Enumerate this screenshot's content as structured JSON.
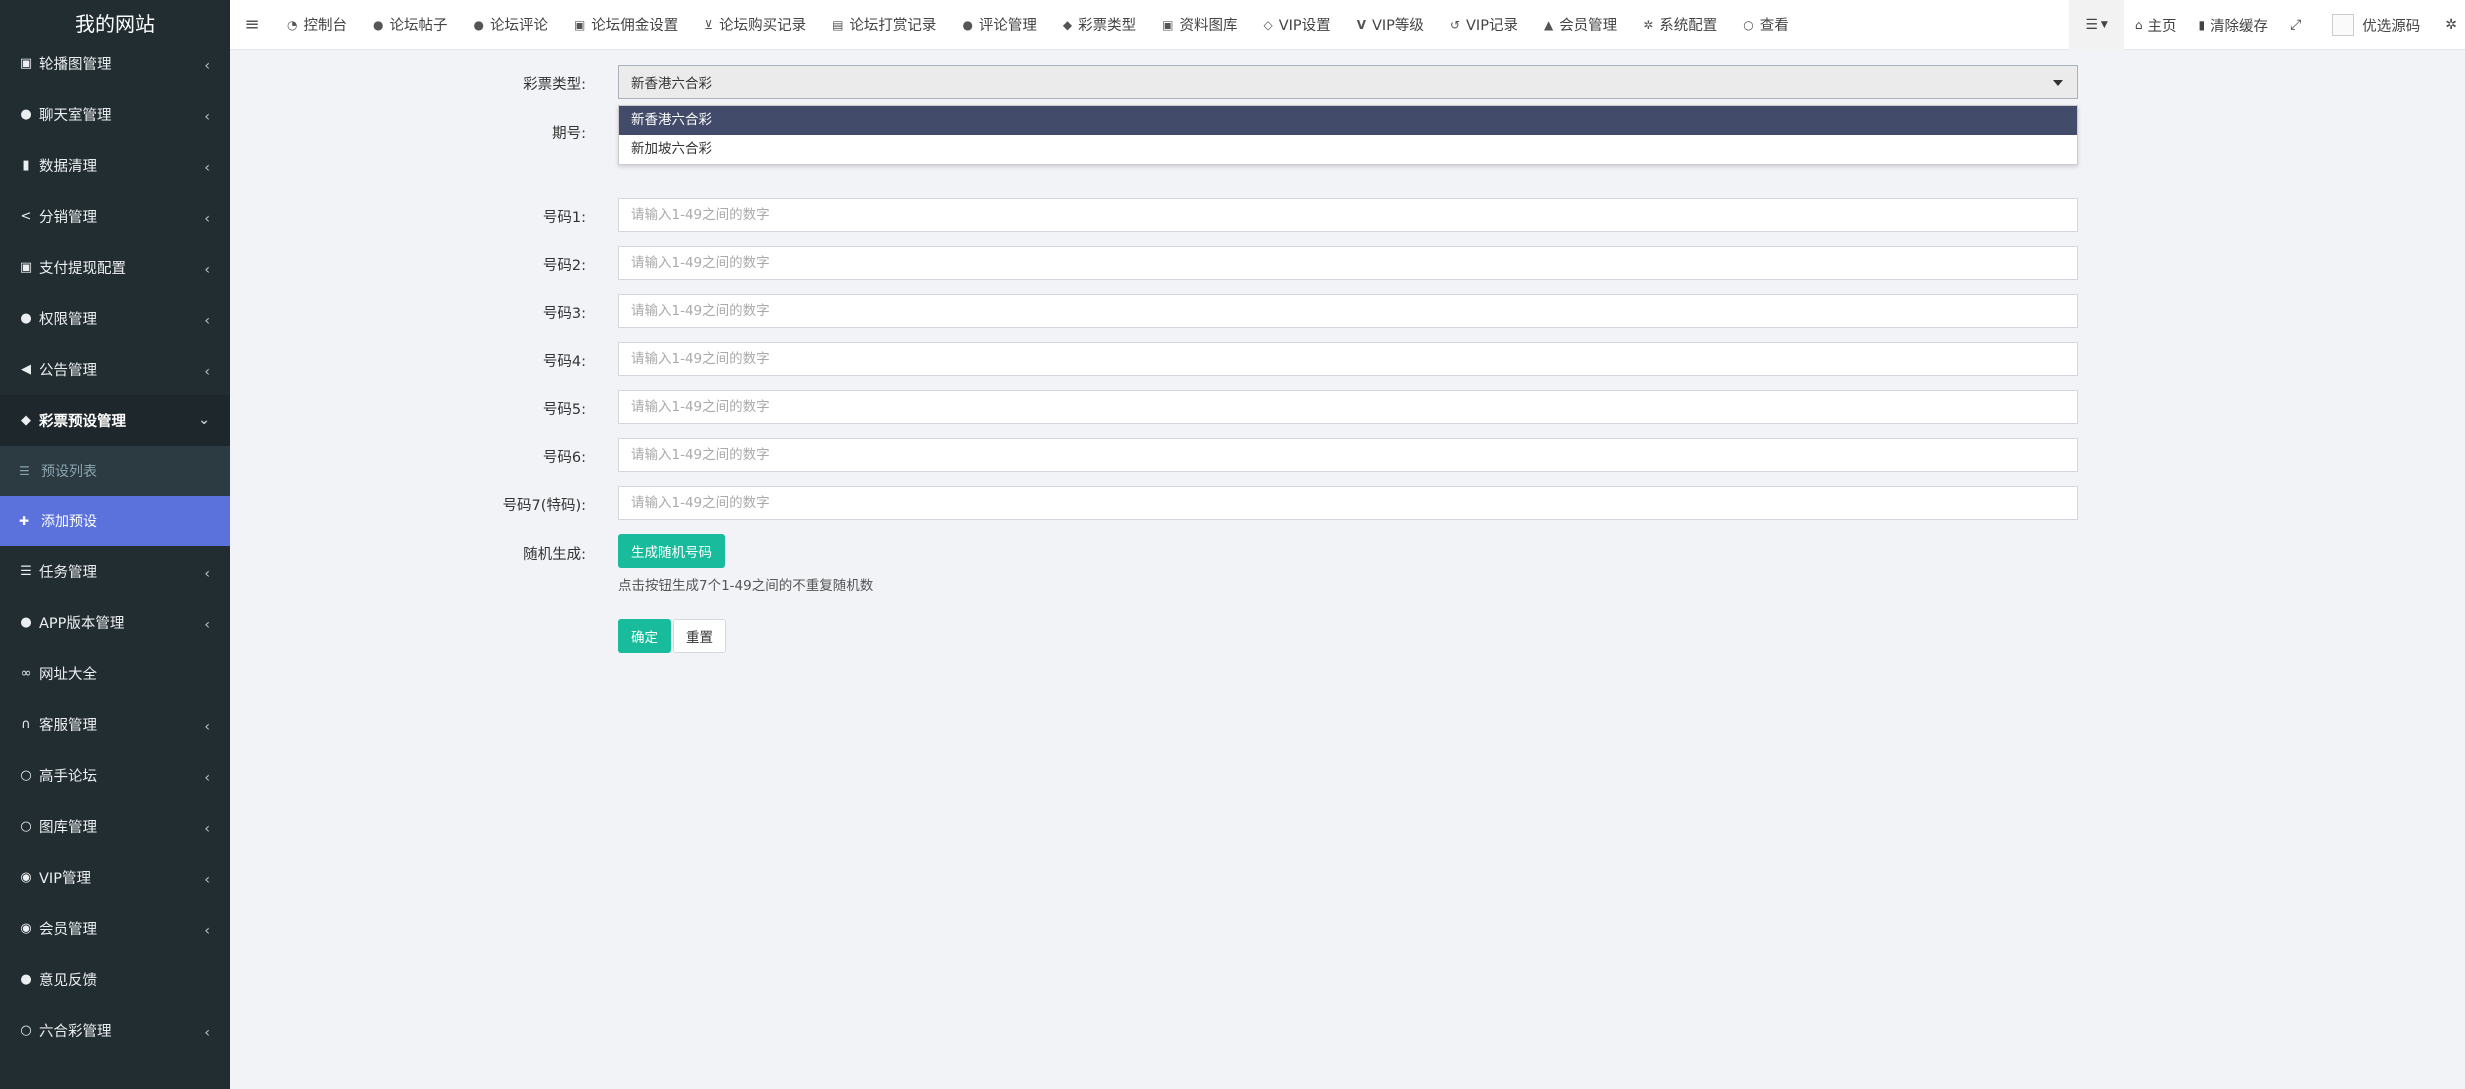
{
  "brand": "我的网站",
  "sidebar": {
    "items": [
      {
        "label": "轮播图管理",
        "icon": "image-icon",
        "glyph": "▣"
      },
      {
        "label": "聊天室管理",
        "icon": "comments-icon",
        "glyph": "●"
      },
      {
        "label": "数据清理",
        "icon": "trash-icon",
        "glyph": "▮"
      },
      {
        "label": "分销管理",
        "icon": "share-icon",
        "glyph": "<"
      },
      {
        "label": "支付提现配置",
        "icon": "money-icon",
        "glyph": "▣"
      },
      {
        "label": "权限管理",
        "icon": "users-icon",
        "glyph": "●"
      },
      {
        "label": "公告管理",
        "icon": "bullhorn-icon",
        "glyph": "◀"
      },
      {
        "label": "彩票预设管理",
        "icon": "tag-icon",
        "glyph": "◆"
      }
    ],
    "subitems": [
      {
        "label": "预设列表",
        "icon": "list-icon",
        "glyph": "☰"
      },
      {
        "label": "添加预设",
        "icon": "plus-icon",
        "glyph": "✚"
      }
    ],
    "items2": [
      {
        "label": "任务管理",
        "icon": "tasks-icon",
        "glyph": "☰"
      },
      {
        "label": "APP版本管理",
        "icon": "android-icon",
        "glyph": "●"
      },
      {
        "label": "网址大全",
        "icon": "link-icon",
        "glyph": "∞"
      },
      {
        "label": "客服管理",
        "icon": "headset-icon",
        "glyph": "∩"
      },
      {
        "label": "高手论坛",
        "icon": "circle-icon",
        "glyph": "○"
      },
      {
        "label": "图库管理",
        "icon": "circle-icon",
        "glyph": "○"
      },
      {
        "label": "VIP管理",
        "icon": "vip-icon",
        "glyph": "◉"
      },
      {
        "label": "会员管理",
        "icon": "user-circle-icon",
        "glyph": "◉"
      },
      {
        "label": "意见反馈",
        "icon": "comment-icon",
        "glyph": "●"
      },
      {
        "label": "六合彩管理",
        "icon": "circle-icon",
        "glyph": "○"
      }
    ]
  },
  "topnav": [
    {
      "label": "控制台",
      "icon": "dashboard-icon",
      "glyph": "◔"
    },
    {
      "label": "论坛帖子",
      "icon": "comment-icon",
      "glyph": "●"
    },
    {
      "label": "论坛评论",
      "icon": "comments-icon",
      "glyph": "●"
    },
    {
      "label": "论坛佣金设置",
      "icon": "money-icon",
      "glyph": "▣"
    },
    {
      "label": "论坛购买记录",
      "icon": "cart-icon",
      "glyph": "⊻"
    },
    {
      "label": "论坛打赏记录",
      "icon": "gift-icon",
      "glyph": "▤"
    },
    {
      "label": "评论管理",
      "icon": "comments-icon",
      "glyph": "●"
    },
    {
      "label": "彩票类型",
      "icon": "tag-icon",
      "glyph": "◆"
    },
    {
      "label": "资料图库",
      "icon": "image-icon",
      "glyph": "▣"
    },
    {
      "label": "VIP设置",
      "icon": "diamond-icon",
      "glyph": "◇"
    },
    {
      "label": "VIP等级",
      "icon": "vimeo-icon",
      "glyph": "V"
    },
    {
      "label": "VIP记录",
      "icon": "history-icon",
      "glyph": "↺"
    },
    {
      "label": "会员管理",
      "icon": "user-icon",
      "glyph": "▲"
    },
    {
      "label": "系统配置",
      "icon": "gear-icon",
      "glyph": "✲"
    },
    {
      "label": "查看",
      "icon": "circle-icon",
      "glyph": "○"
    }
  ],
  "right_tools": {
    "home": "主页",
    "clear_cache": "清除缓存",
    "user_name": "优选源码"
  },
  "form": {
    "lottery_type_label": "彩票类型:",
    "lottery_type_value": "新香港六合彩",
    "lottery_options": [
      "新香港六合彩",
      "新加坡六合彩"
    ],
    "period_label": "期号:",
    "numbers": [
      {
        "label": "号码1:",
        "placeholder": "请输入1-49之间的数字"
      },
      {
        "label": "号码2:",
        "placeholder": "请输入1-49之间的数字"
      },
      {
        "label": "号码3:",
        "placeholder": "请输入1-49之间的数字"
      },
      {
        "label": "号码4:",
        "placeholder": "请输入1-49之间的数字"
      },
      {
        "label": "号码5:",
        "placeholder": "请输入1-49之间的数字"
      },
      {
        "label": "号码6:",
        "placeholder": "请输入1-49之间的数字"
      },
      {
        "label": "号码7(特码):",
        "placeholder": "请输入1-49之间的数字"
      }
    ],
    "random_label": "随机生成:",
    "random_button": "生成随机号码",
    "random_hint": "点击按钮生成7个1-49之间的不重复随机数",
    "submit": "确定",
    "reset": "重置"
  }
}
